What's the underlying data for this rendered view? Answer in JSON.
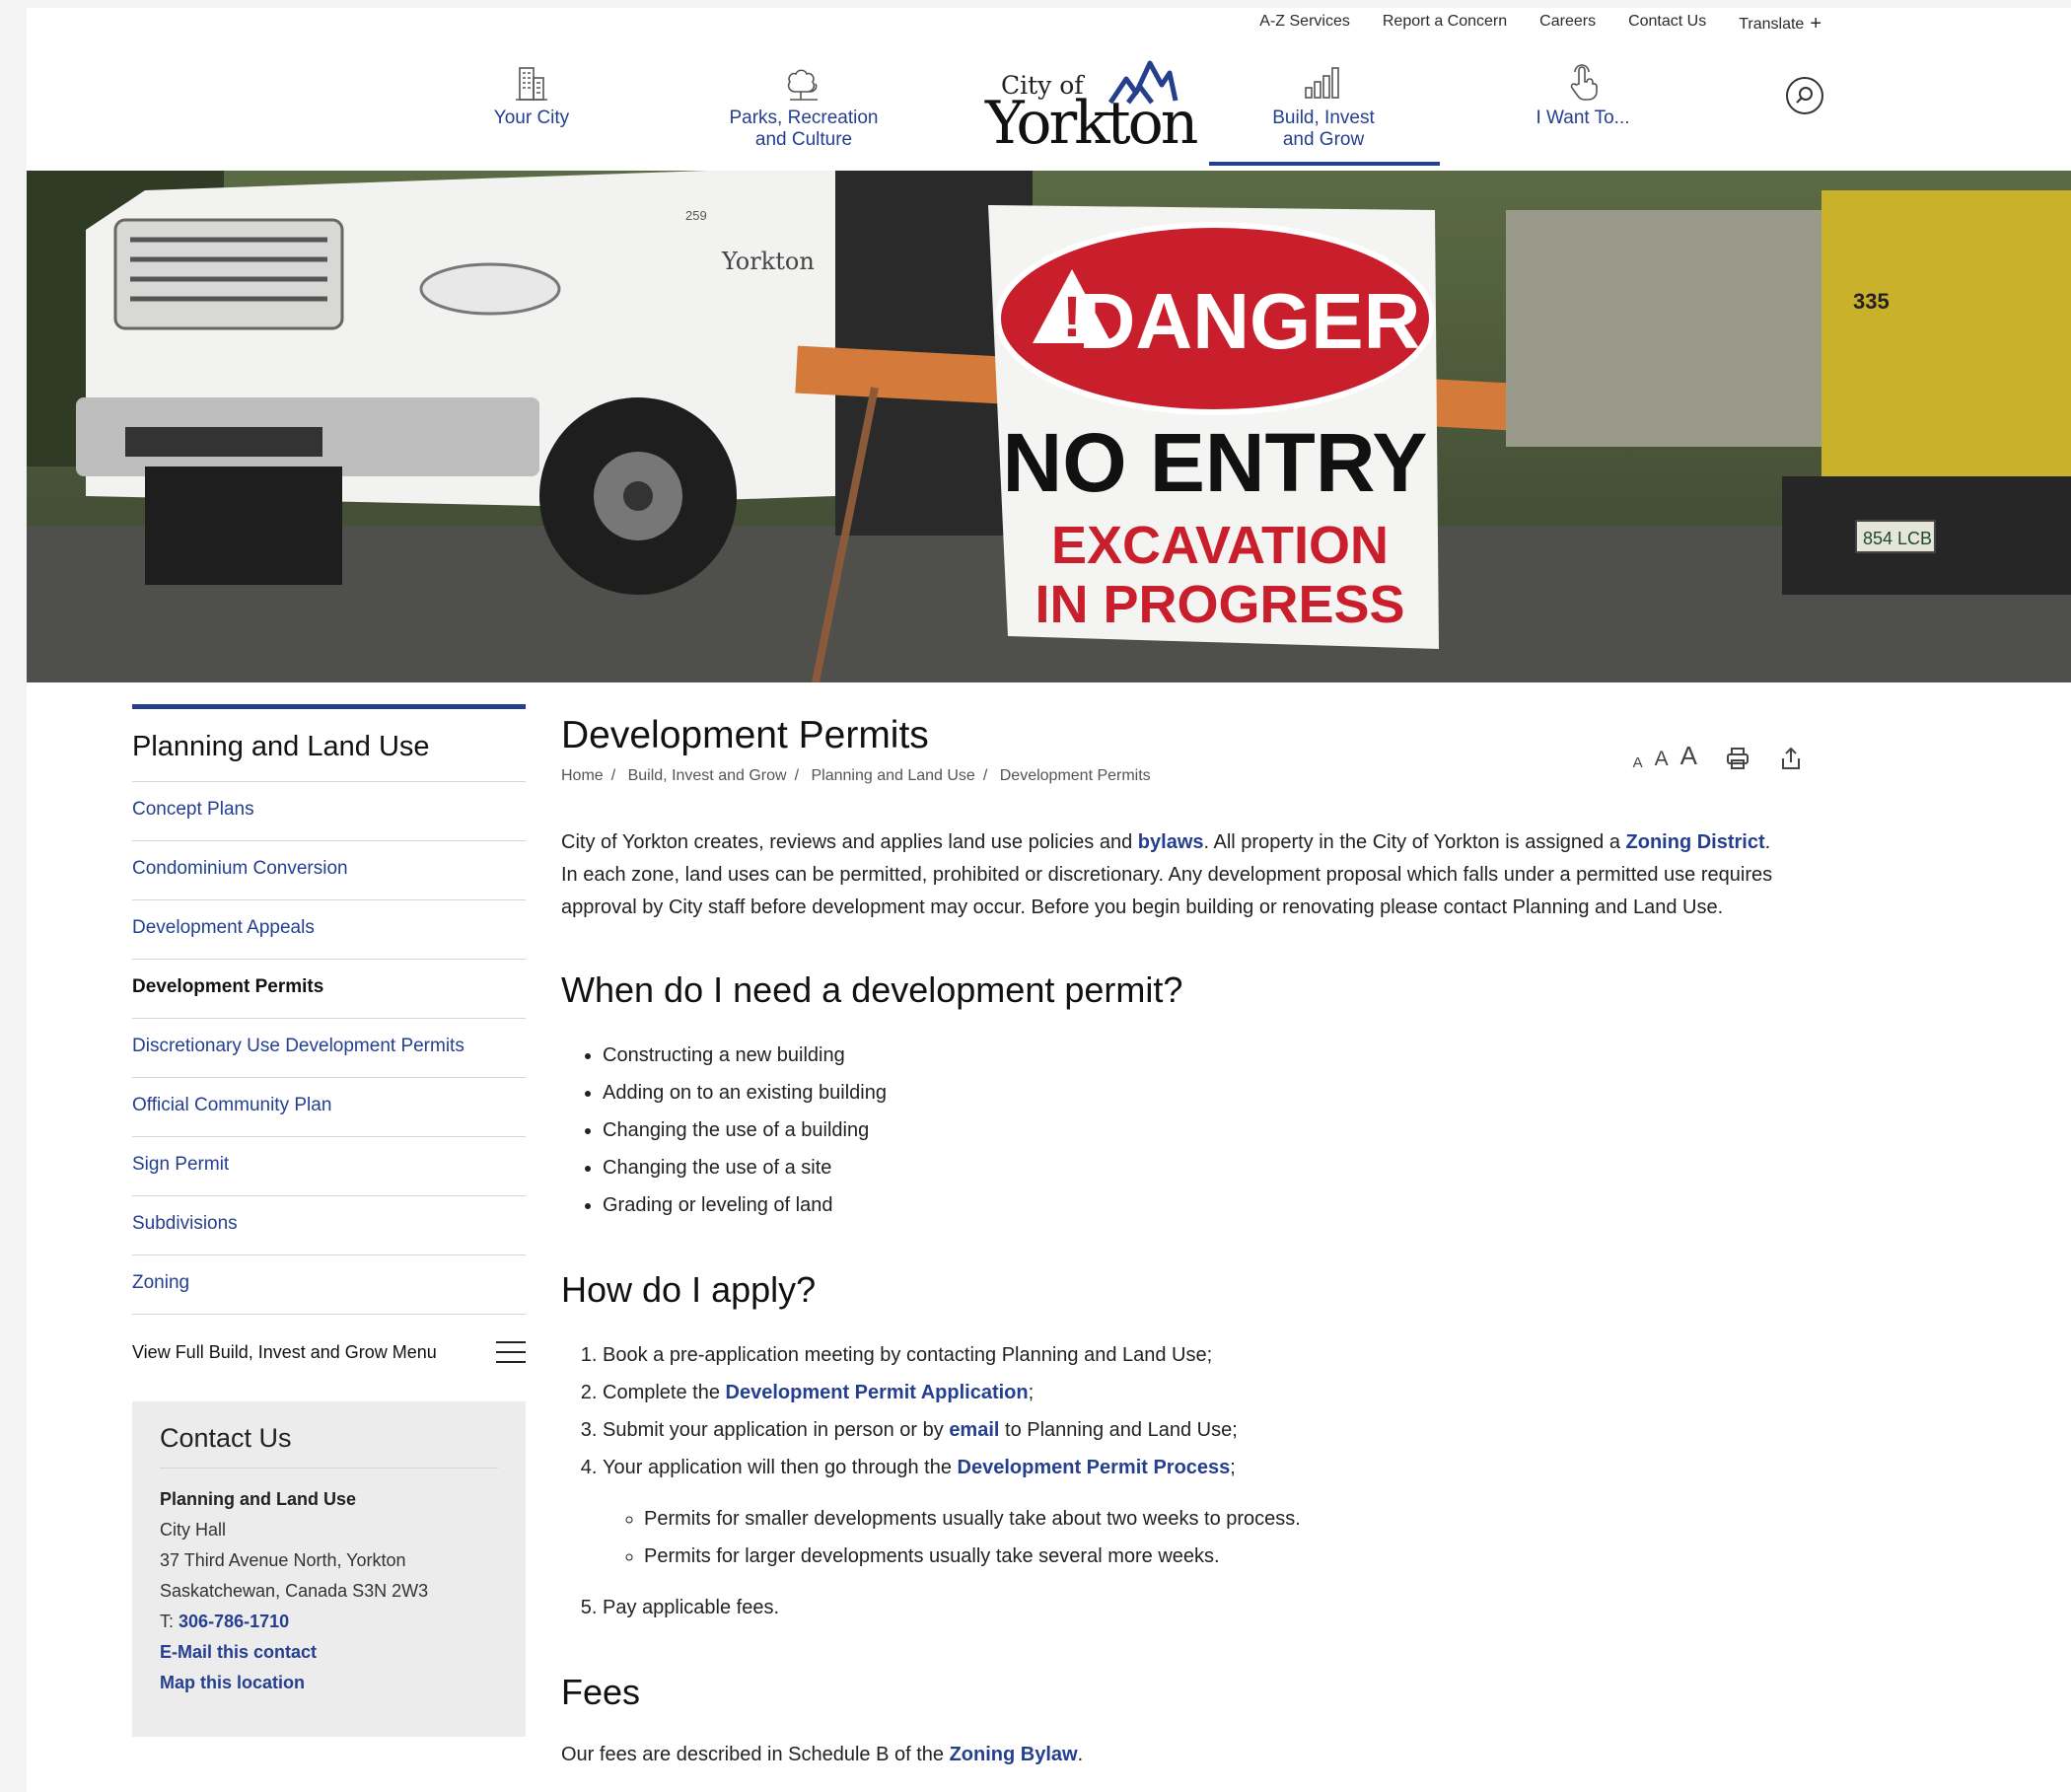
{
  "utility_links": [
    "A-Z Services",
    "Report a Concern",
    "Careers",
    "Contact Us",
    "Translate"
  ],
  "nav": {
    "your_city": "Your City",
    "parks_line1": "Parks, Recreation",
    "parks_line2": "and Culture",
    "build_line1": "Build, Invest",
    "build_line2": "and Grow",
    "i_want": "I Want To...",
    "active_color": "#253f8f"
  },
  "logo": {
    "city_of": "City of",
    "name": "Yorkton"
  },
  "hero": {
    "sign_line1": "DANGER",
    "sign_line2": "NO ENTRY",
    "sign_line3": "EXCAVATION",
    "sign_line4": "IN PROGRESS",
    "truck_number": "259",
    "loader_number": "335",
    "plate": "854 LCB",
    "truck_logo": "Yorkton"
  },
  "sidebar": {
    "title": "Planning and Land Use",
    "items": [
      {
        "label": "Concept Plans"
      },
      {
        "label": "Condominium Conversion"
      },
      {
        "label": "Development Appeals"
      },
      {
        "label": "Development Permits"
      },
      {
        "label": "Discretionary Use Development Permits"
      },
      {
        "label": "Official Community Plan"
      },
      {
        "label": "Sign Permit"
      },
      {
        "label": "Subdivisions"
      },
      {
        "label": "Zoning"
      }
    ],
    "current_index": 3,
    "full_menu": "View Full Build, Invest and Grow Menu"
  },
  "contact": {
    "title": "Contact Us",
    "dept": "Planning and Land Use",
    "building": "City Hall",
    "address1": "37 Third Avenue North, Yorkton",
    "address2": "Saskatchewan, Canada S3N 2W3",
    "phone_prefix": "T:",
    "phone": "306-786-1710",
    "email": "E-Mail this contact",
    "map": "Map this location"
  },
  "page": {
    "title": "Development Permits",
    "breadcrumb": [
      "Home",
      "Build, Invest and Grow",
      "Planning and Land Use",
      "Development Permits"
    ],
    "font_sizes": [
      "A",
      "A",
      "A"
    ],
    "intro": {
      "t1": "City of Yorkton creates, reviews and applies land use policies and ",
      "l1": "bylaws",
      "t2": ". All property in the City of Yorkton is assigned a ",
      "l2": "Zoning District",
      "t3": ". In each zone, land uses can be permitted, prohibited or discretionary. Any development proposal which falls under a permitted use requires approval by City staff before development may occur. Before you begin building or renovating please contact Planning and Land Use."
    },
    "when_heading": "When do I need a development permit?",
    "when_items": [
      "Constructing a new building",
      "Adding on to an existing building",
      "Changing the use of a building",
      "Changing the use of a site",
      "Grading or leveling of land"
    ],
    "apply_heading": "How do I apply?",
    "apply": {
      "s1": "Book a pre-application meeting by contacting Planning and Land Use;",
      "s2a": "Complete the ",
      "s2l": "Development Permit Application",
      "s2b": ";",
      "s3a": "Submit your application in person or by ",
      "s3l": "email",
      "s3b": " to Planning and Land Use;",
      "s4a": "Your application will then go through the ",
      "s4l": "Development Permit Process",
      "s4b": ";",
      "sub1": "Permits for smaller developments usually take about two weeks to process.",
      "sub2": "Permits for larger developments usually take several more weeks.",
      "s5": "Pay applicable fees."
    },
    "fees_heading": "Fees",
    "fees": {
      "t1": "Our fees are described in Schedule B of the ",
      "l1": "Zoning Bylaw",
      "t2": "."
    }
  }
}
